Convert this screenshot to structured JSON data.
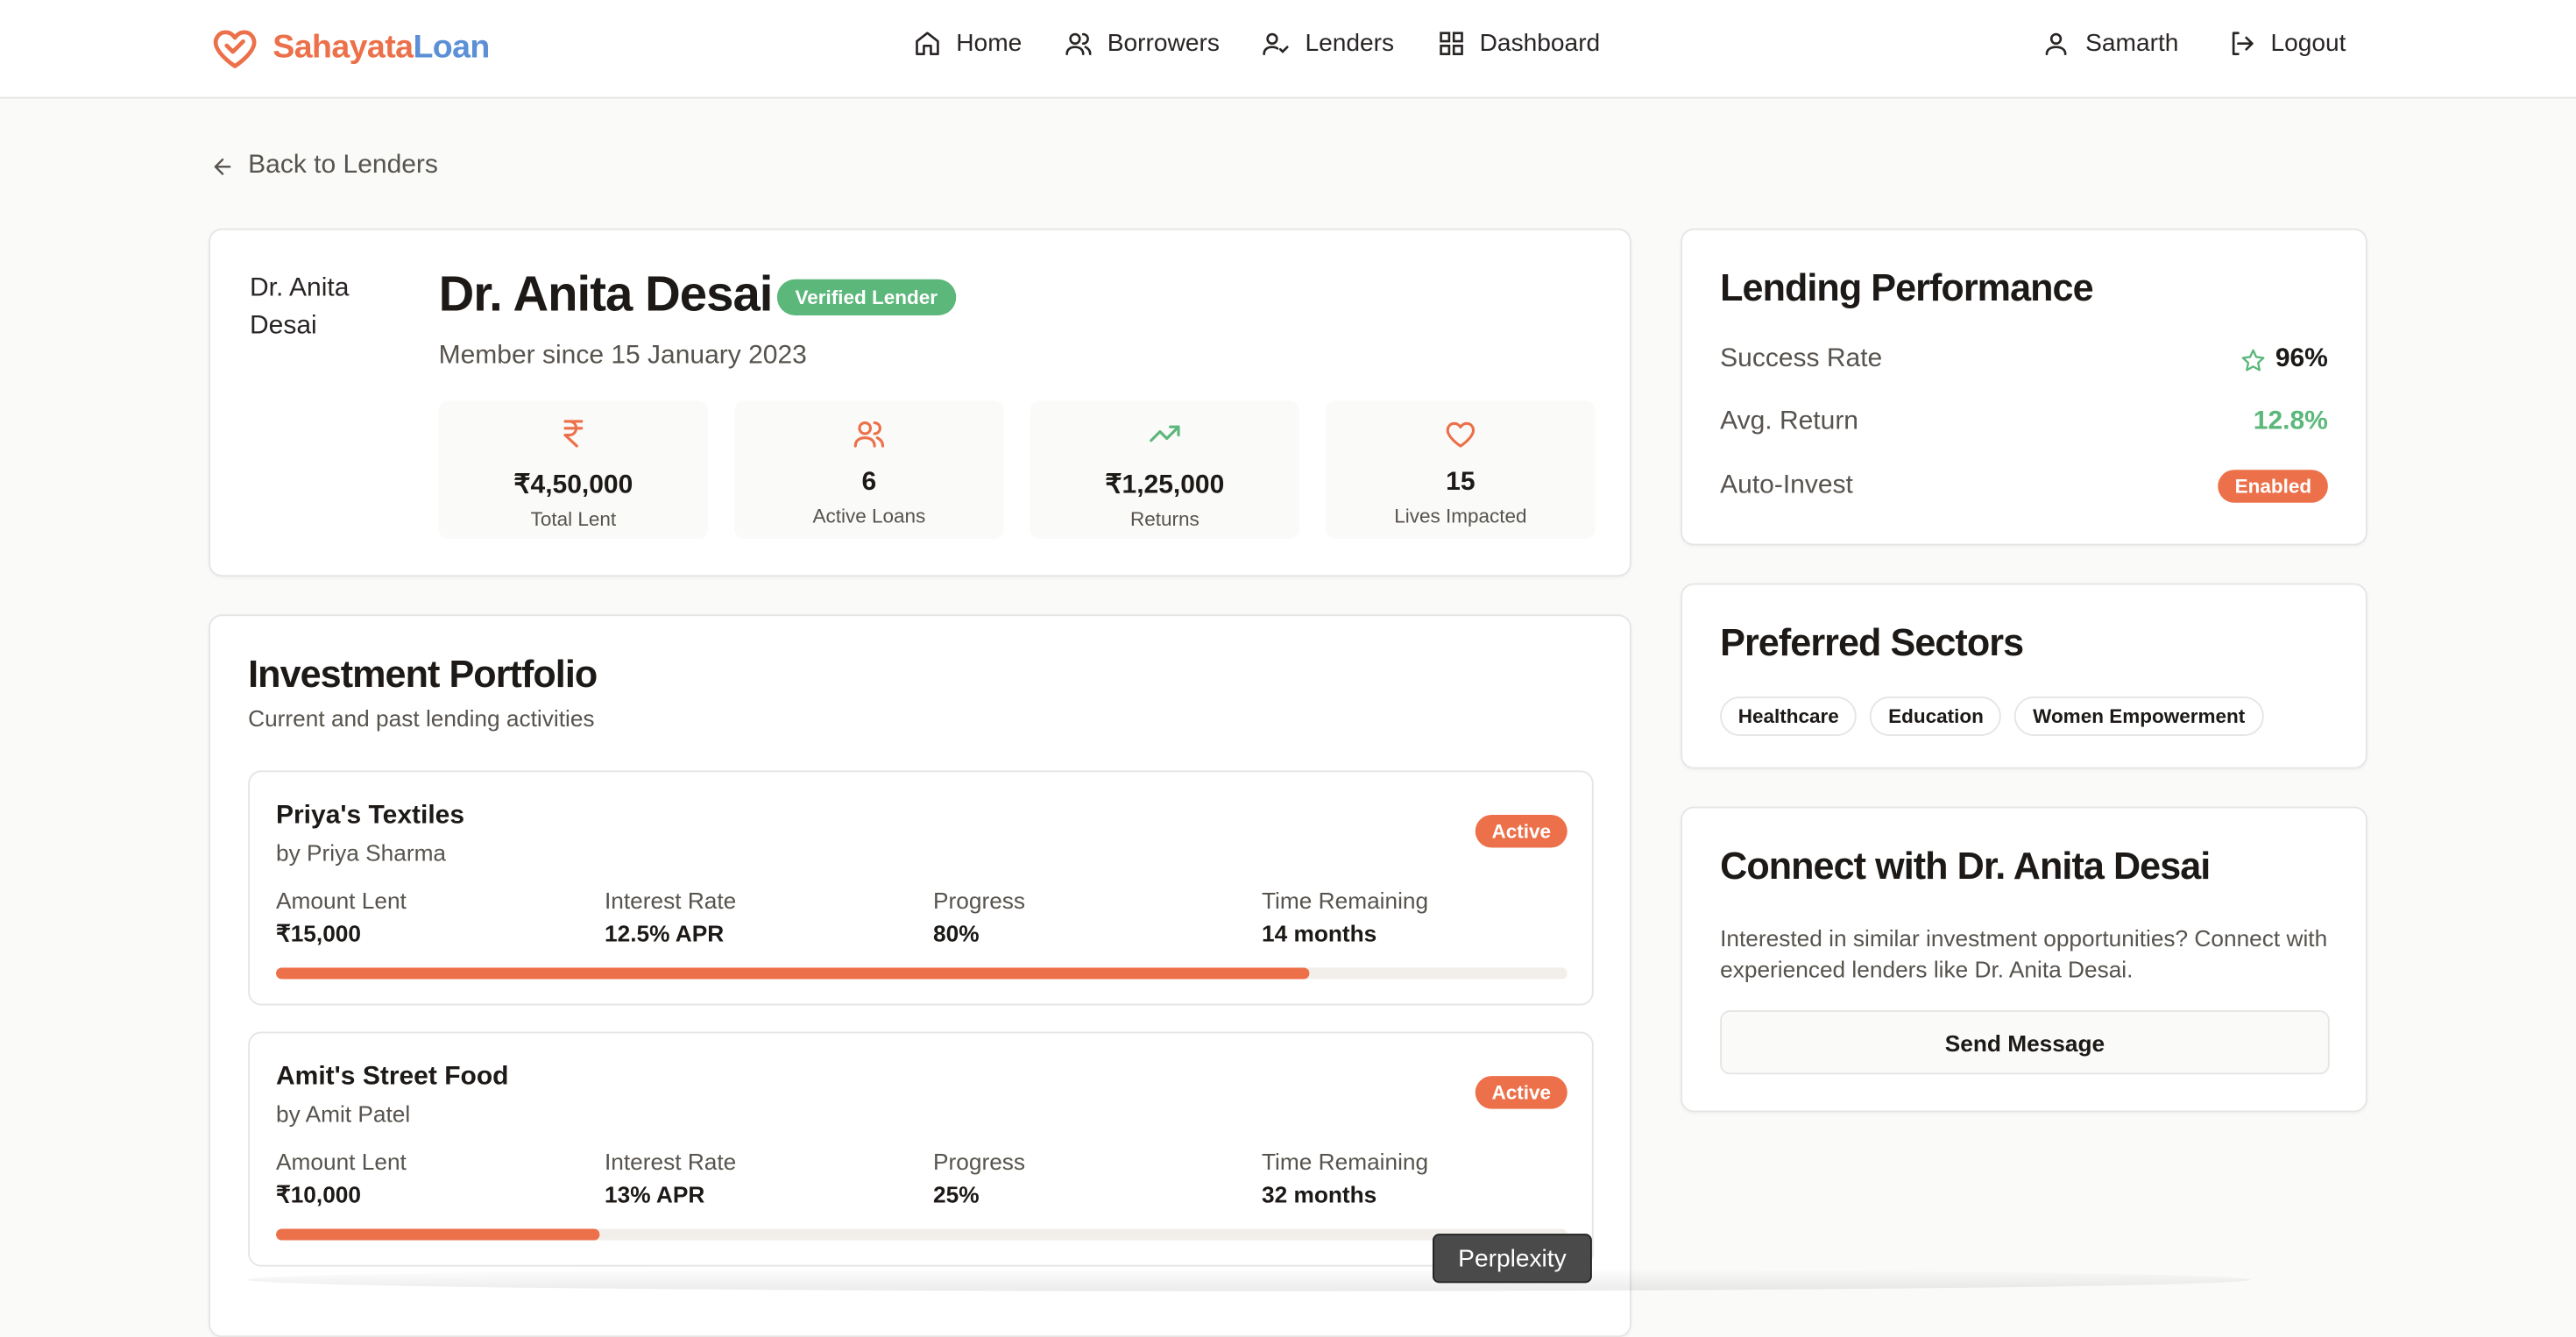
{
  "brand": {
    "name_part1": "Sahayata",
    "name_part2": "Loan",
    "color_primary": "#ec7049",
    "color_secondary": "#5b8fd6"
  },
  "nav": [
    {
      "label": "Home",
      "icon": "home-icon"
    },
    {
      "label": "Borrowers",
      "icon": "users-icon"
    },
    {
      "label": "Lenders",
      "icon": "user-check-icon"
    },
    {
      "label": "Dashboard",
      "icon": "dashboard-icon"
    }
  ],
  "user": {
    "name": "Samarth",
    "logout_label": "Logout"
  },
  "back_label": "Back to Lenders",
  "profile": {
    "avatar_alt": "Dr. Anita Desai",
    "name": "Dr. Anita Desai",
    "badge": "Verified Lender",
    "member_since": "Member since 15 January 2023",
    "stats": [
      {
        "value": "₹4,50,000",
        "label": "Total Lent",
        "icon": "rupee-icon"
      },
      {
        "value": "6",
        "label": "Active Loans",
        "icon": "users-icon"
      },
      {
        "value": "₹1,25,000",
        "label": "Returns",
        "icon": "trending-up-icon"
      },
      {
        "value": "15",
        "label": "Lives Impacted",
        "icon": "heart-icon"
      }
    ]
  },
  "portfolio": {
    "title": "Investment Portfolio",
    "subtitle": "Current and past lending activities",
    "loans": [
      {
        "title": "Priya's Textiles",
        "by": "by Priya Sharma",
        "status": "Active",
        "metrics": [
          {
            "label": "Amount Lent",
            "value": "₹15,000"
          },
          {
            "label": "Interest Rate",
            "value": "12.5% APR"
          },
          {
            "label": "Progress",
            "value": "80%"
          },
          {
            "label": "Time Remaining",
            "value": "14 months"
          }
        ],
        "progress": 80
      },
      {
        "title": "Amit's Street Food",
        "by": "by Amit Patel",
        "status": "Active",
        "metrics": [
          {
            "label": "Amount Lent",
            "value": "₹10,000"
          },
          {
            "label": "Interest Rate",
            "value": "13% APR"
          },
          {
            "label": "Progress",
            "value": "25%"
          },
          {
            "label": "Time Remaining",
            "value": "32 months"
          }
        ],
        "progress": 25
      }
    ]
  },
  "performance": {
    "title": "Lending Performance",
    "success_label": "Success Rate",
    "success_value": "96%",
    "return_label": "Avg. Return",
    "return_value": "12.8%",
    "autoinvest_label": "Auto-Invest",
    "autoinvest_value": "Enabled"
  },
  "sectors": {
    "title": "Preferred Sectors",
    "tags": [
      "Healthcare",
      "Education",
      "Women Empowerment"
    ]
  },
  "connect": {
    "title": "Connect with Dr. Anita Desai",
    "text": "Interested in similar investment opportunities? Connect with experienced lenders like Dr. Anita Desai.",
    "button": "Send Message"
  },
  "tooltip": "Perplexity"
}
